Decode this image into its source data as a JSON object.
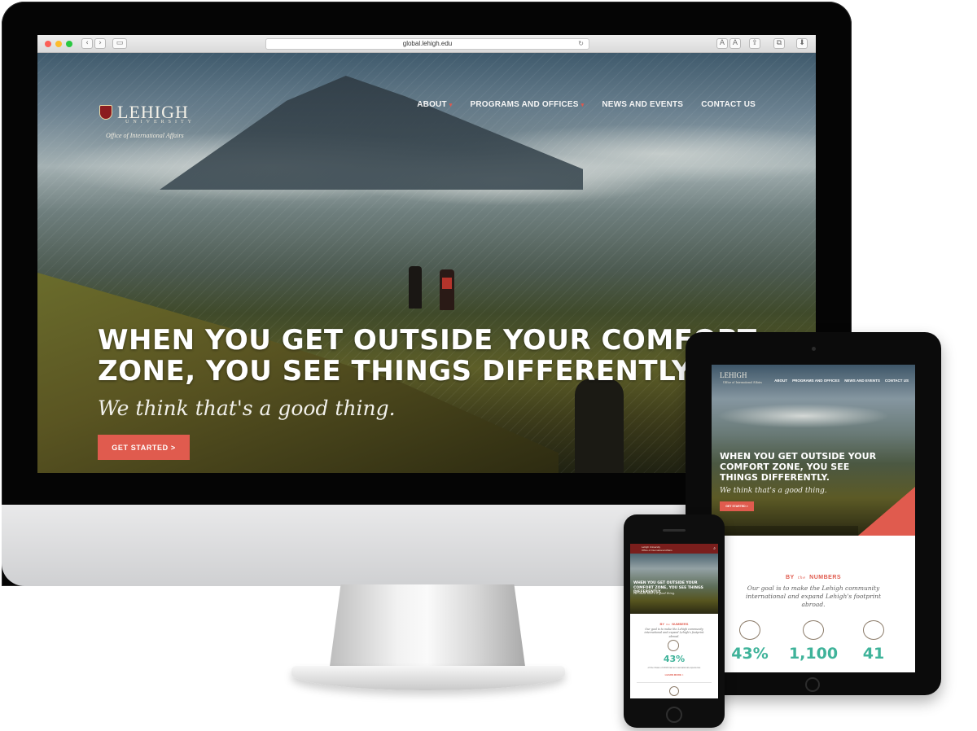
{
  "browser": {
    "url": "global.lehigh.edu",
    "back_glyph": "‹",
    "forward_glyph": "›",
    "sidebar_glyph": "▭",
    "reload_glyph": "↻",
    "toolbar_glyphs": [
      "A",
      "A",
      "⇪",
      "⧉",
      "⬇"
    ]
  },
  "site": {
    "logo_word": "LEHIGH",
    "logo_sub": "UNIVERSITY",
    "logo_office": "Office of International Affairs",
    "nav": [
      {
        "label": "ABOUT",
        "has_caret": true
      },
      {
        "label": "PROGRAMS AND OFFICES",
        "has_caret": true
      },
      {
        "label": "NEWS AND EVENTS",
        "has_caret": false
      },
      {
        "label": "CONTACT US",
        "has_caret": false
      }
    ],
    "caret_glyph": "▾",
    "headline_line1": "WHEN YOU GET OUTSIDE YOUR COMFORT",
    "headline_line2": "ZONE, YOU SEE THINGS DIFFERENTLY.",
    "tagline": "We think that's a good thing.",
    "cta_label": "GET STARTED >"
  },
  "tablet": {
    "logo": "LEHIGH",
    "logo_sub": "Office of International Affairs",
    "nav": [
      "ABOUT",
      "PROGRAMS AND OFFICES",
      "NEWS AND EVENTS",
      "CONTACT US"
    ],
    "headline_line1": "WHEN YOU GET OUTSIDE YOUR",
    "headline_line2": "COMFORT ZONE, YOU SEE",
    "headline_line3": "THINGS DIFFERENTLY.",
    "tagline": "We think that's a good thing.",
    "cta_label": "GET STARTED >",
    "by_left": "BY",
    "by_small": "the",
    "by_right": "NUMBERS",
    "goal": "Our goal is to make the Lehigh community international and expand Lehigh's footprint abroad.",
    "stats": [
      "43%",
      "1,100",
      "41"
    ]
  },
  "phone": {
    "top_title": "Lehigh University",
    "top_sub": "Office of International Affairs",
    "search_glyph": "⌕",
    "headline": "WHEN YOU GET OUTSIDE YOUR COMFORT ZONE, YOU SEE THINGS DIFFERENTLY.",
    "tagline": "We think that's a good thing.",
    "by_left": "BY",
    "by_small": "the",
    "by_right": "NUMBERS",
    "goal": "Our goal is to make the Lehigh community international and expand Lehigh's footprint abroad.",
    "stat": "43%",
    "stat_desc": "of the Class of 2016 had an international experience",
    "learn_more": "LEARN MORE >"
  },
  "colors": {
    "accent": "#e05b4e",
    "stat_teal": "#3fb39a",
    "lehigh_brown": "#7a1e1c"
  }
}
